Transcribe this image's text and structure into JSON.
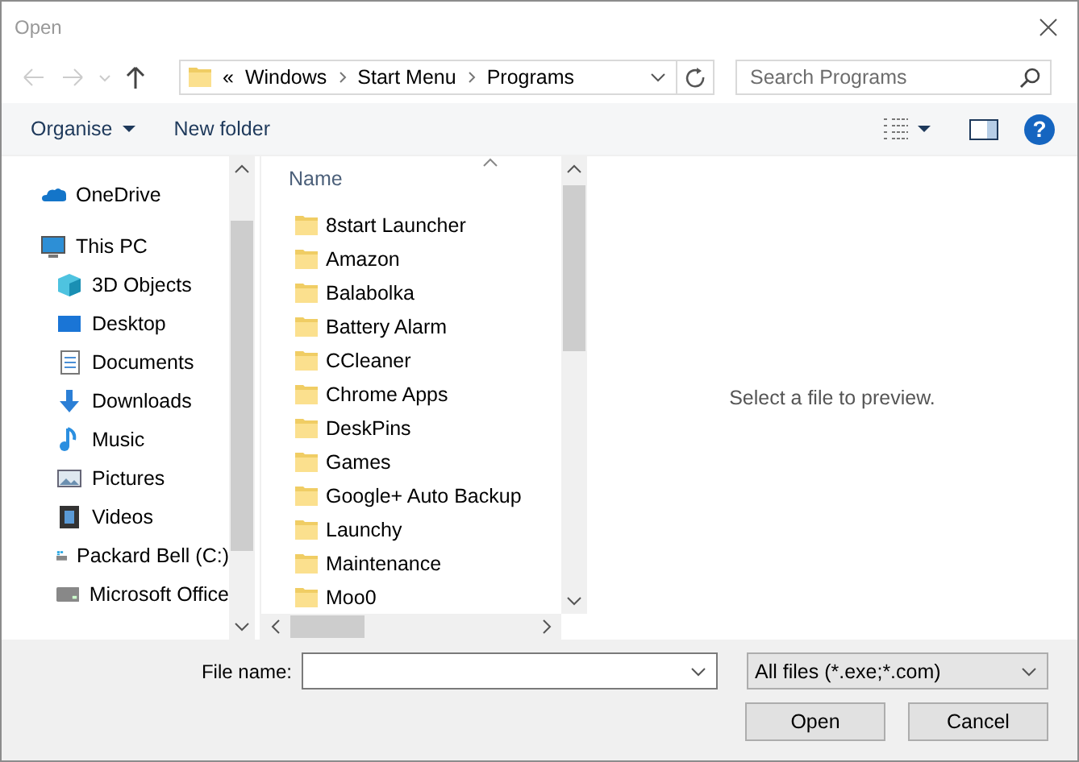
{
  "window": {
    "title": "Open"
  },
  "address": {
    "overflow": "«",
    "path": [
      "Windows",
      "Start Menu",
      "Programs"
    ]
  },
  "search": {
    "placeholder": "Search Programs"
  },
  "toolbar": {
    "organise": "Organise",
    "new_folder": "New folder",
    "help": "?"
  },
  "nav": {
    "items": [
      {
        "label": "OneDrive",
        "kind": "cloud"
      },
      {
        "label": "This PC",
        "kind": "computer",
        "children": [
          {
            "label": "3D Objects",
            "kind": "cube"
          },
          {
            "label": "Desktop",
            "kind": "desktop"
          },
          {
            "label": "Documents",
            "kind": "document"
          },
          {
            "label": "Downloads",
            "kind": "download"
          },
          {
            "label": "Music",
            "kind": "music"
          },
          {
            "label": "Pictures",
            "kind": "picture"
          },
          {
            "label": "Videos",
            "kind": "video"
          },
          {
            "label": "Packard Bell (C:)",
            "kind": "system-drive"
          },
          {
            "label": "Microsoft Office",
            "kind": "drive"
          }
        ]
      }
    ]
  },
  "file_list": {
    "column": "Name",
    "items": [
      "8start Launcher",
      "Amazon",
      "Balabolka",
      "Battery Alarm",
      "CCleaner",
      "Chrome Apps",
      "DeskPins",
      "Games",
      "Google+ Auto Backup",
      "Launchy",
      "Maintenance",
      "Moo0"
    ]
  },
  "preview": {
    "message": "Select a file to preview."
  },
  "footer": {
    "file_name_label": "File name:",
    "filter": "All files (*.exe;*.com)",
    "buttons": [
      "Open",
      "Cancel"
    ]
  }
}
